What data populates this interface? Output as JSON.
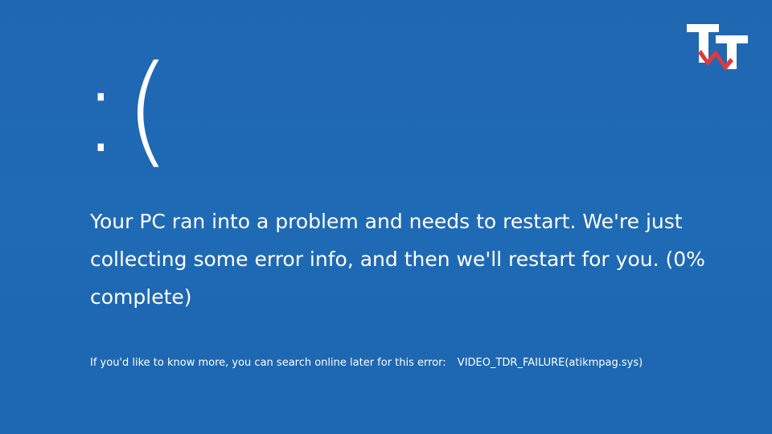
{
  "bsod": {
    "emoticon": ":(",
    "message": "Your PC ran into a problem and needs to restart. We're just collecting some error info, and then we'll restart for you. (0% complete)",
    "progress_percent": 0,
    "more_info_prompt": "If you'd like to know more, you can search online later for this error:",
    "stop_code": "VIDEO_TDR_FAILURE(atikmpag.sys)"
  },
  "colors": {
    "background": "#1f69b3",
    "text": "#ffffff",
    "logo_red": "#e0393e"
  },
  "logo": {
    "icon": "tt-watermark-logo"
  }
}
